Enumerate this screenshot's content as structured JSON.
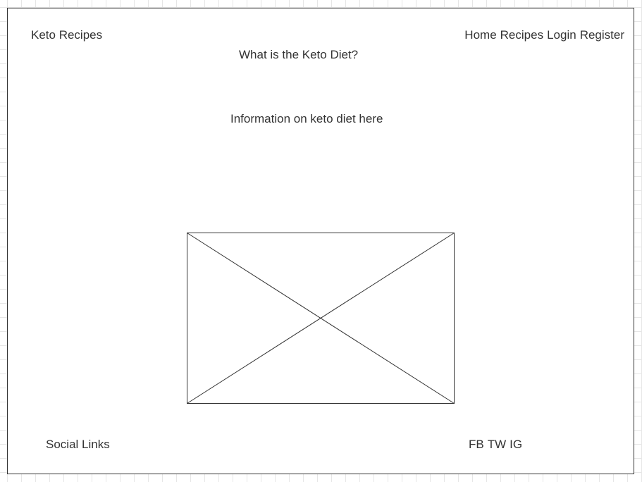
{
  "header": {
    "brand": "Keto Recipes",
    "nav": {
      "home": "Home",
      "recipes": "Recipes",
      "login": "Login",
      "register": "Register"
    }
  },
  "main": {
    "heading": "What is the Keto Diet?",
    "info": "Information on keto diet here",
    "image_placeholder": "image-placeholder"
  },
  "footer": {
    "social_label": "Social Links",
    "links": {
      "fb": "FB",
      "tw": "TW",
      "ig": "IG"
    }
  },
  "colors": {
    "stroke": "#333333",
    "grid": "#e6e6e6",
    "background": "#ffffff"
  }
}
